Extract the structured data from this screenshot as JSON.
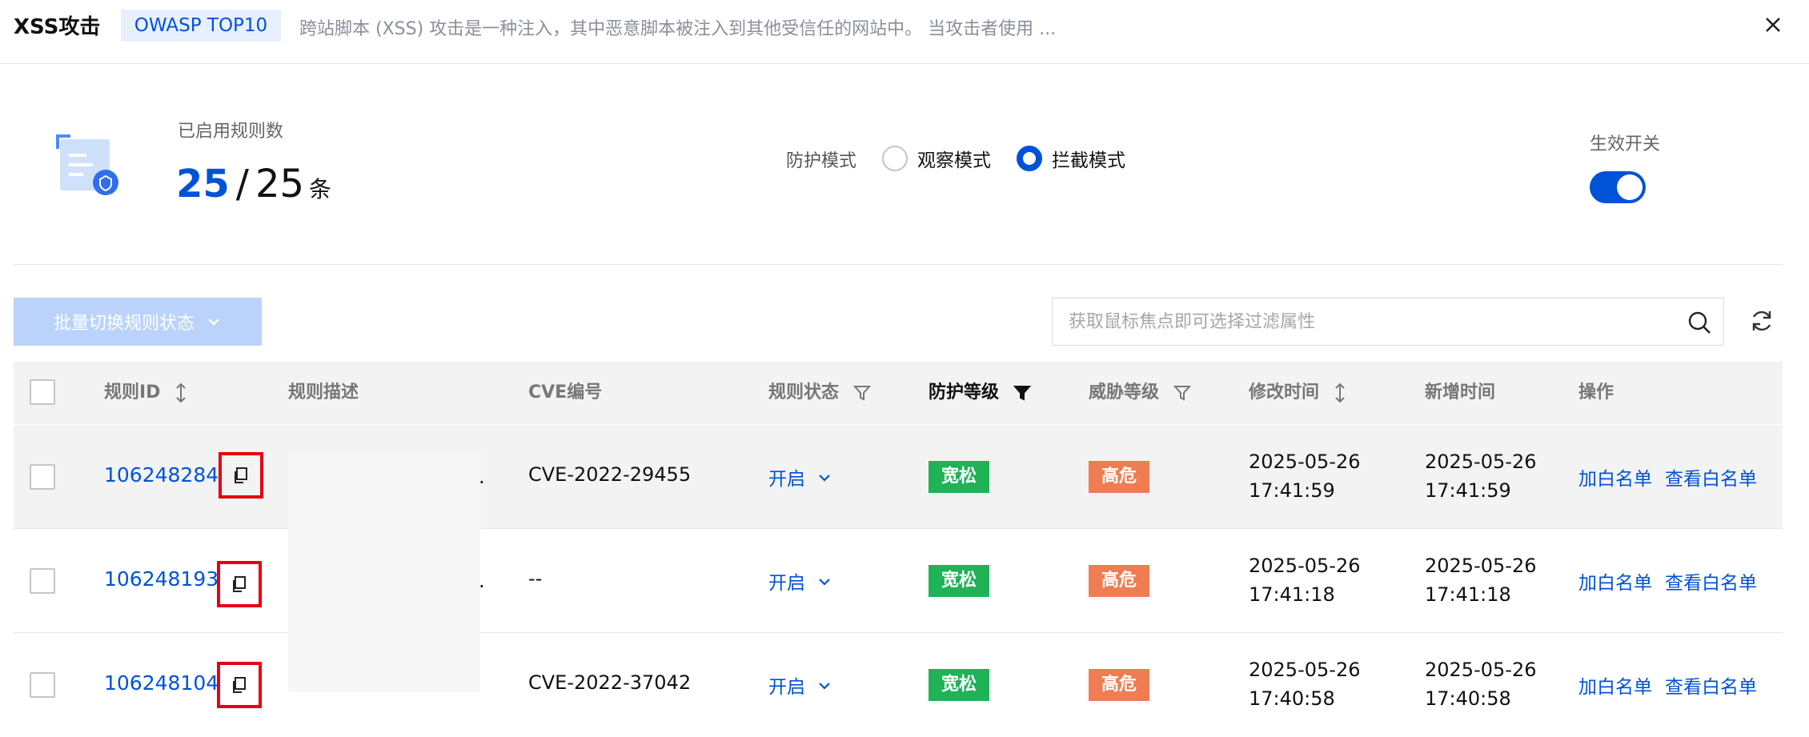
{
  "header": {
    "title": "XSS攻击",
    "tag": "OWASP TOP10",
    "description": "跨站脚本 (XSS) 攻击是一种注入，其中恶意脚本被注入到其他受信任的网站中。 当攻击者使用 ..."
  },
  "stats": {
    "label": "已启用规则数",
    "enabled": "25",
    "slash": "/",
    "total": "25",
    "unit": "条"
  },
  "mode": {
    "label": "防护模式",
    "options": [
      "观察模式",
      "拦截模式"
    ],
    "selected": "拦截模式"
  },
  "switch": {
    "label": "生效开关",
    "on": true
  },
  "toolbar": {
    "batch_label": "批量切换规则状态",
    "search_placeholder": "获取鼠标焦点即可选择过滤属性"
  },
  "table": {
    "columns": [
      "规则ID",
      "规则描述",
      "CVE编号",
      "规则状态",
      "防护等级",
      "威胁等级",
      "修改时间",
      "新增时间",
      "操作"
    ],
    "rows": [
      {
        "id": "106248284",
        "cve": "CVE-2022-29455",
        "status": "开启",
        "protection": "宽松",
        "threat": "高危",
        "modified_date": "2025-05-26",
        "modified_time": "17:41:59",
        "added_date": "2025-05-26",
        "added_time": "17:41:59",
        "action_add": "加白名单",
        "action_view": "查看白名单"
      },
      {
        "id": "106248193",
        "cve": "--",
        "status": "开启",
        "protection": "宽松",
        "threat": "高危",
        "modified_date": "2025-05-26",
        "modified_time": "17:41:18",
        "added_date": "2025-05-26",
        "added_time": "17:41:18",
        "action_add": "加白名单",
        "action_view": "查看白名单"
      },
      {
        "id": "106248104",
        "cve": "CVE-2022-37042",
        "status": "开启",
        "protection": "宽松",
        "threat": "高危",
        "modified_date": "2025-05-26",
        "modified_time": "17:40:58",
        "added_date": "2025-05-26",
        "added_time": "17:40:58",
        "action_add": "加白名单",
        "action_view": "查看白名单"
      }
    ]
  },
  "colors": {
    "accent": "#0052d9",
    "badge_green": "#1fb356",
    "badge_orange": "#f07c54",
    "highlight_box": "#e60012"
  },
  "icons": [
    "close-icon",
    "rules-illustration-icon",
    "search-icon",
    "refresh-icon",
    "sort-icon",
    "filter-icon",
    "copy-icon",
    "chevron-down-icon"
  ]
}
